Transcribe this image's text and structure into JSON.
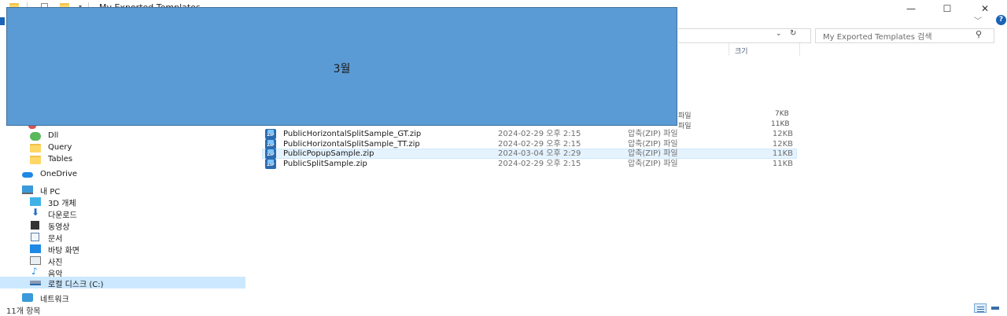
{
  "window": {
    "title": "My Exported Templates",
    "minimize": "—",
    "maximize": "☐",
    "close": "✕"
  },
  "ribbon": {
    "expand_chevron": "﹀",
    "help": "?"
  },
  "search": {
    "placeholder": "My Exported Templates 검색"
  },
  "columns": {
    "size": "크기"
  },
  "overlay": {
    "text": "3월"
  },
  "peek_rows": [
    {
      "type_suffix": "파일",
      "size": "7KB"
    },
    {
      "type_suffix": "파일",
      "size": "11KB"
    }
  ],
  "nav": {
    "items": [
      {
        "label": "Dll"
      },
      {
        "label": "Query"
      },
      {
        "label": "Tables"
      },
      {
        "label": "OneDrive"
      },
      {
        "label": "내 PC"
      },
      {
        "label": "3D 개체"
      },
      {
        "label": "다운로드"
      },
      {
        "label": "동영상"
      },
      {
        "label": "문서"
      },
      {
        "label": "바탕 화면"
      },
      {
        "label": "사진"
      },
      {
        "label": "음악"
      },
      {
        "label": "로컬 디스크 (C:)"
      },
      {
        "label": "네트워크"
      }
    ]
  },
  "files": [
    {
      "name": "PublicHorizontalSplitSample_GT.zip",
      "date": "2024-02-29 오후 2:15",
      "type": "압축(ZIP) 파일",
      "size": "12KB"
    },
    {
      "name": "PublicHorizontalSplitSample_TT.zip",
      "date": "2024-02-29 오후 2:15",
      "type": "압축(ZIP) 파일",
      "size": "12KB"
    },
    {
      "name": "PublicPopupSample.zip",
      "date": "2024-03-04 오후 2:29",
      "type": "압축(ZIP) 파일",
      "size": "11KB"
    },
    {
      "name": "PublicSplitSample.zip",
      "date": "2024-02-29 오후 2:15",
      "type": "압축(ZIP) 파일",
      "size": "11KB"
    }
  ],
  "status": {
    "count": "11개 항목"
  },
  "colors": {
    "accent": "#1a63b6",
    "overlay": "#5b9bd5",
    "selection": "#cce8ff",
    "folder": "#ffd766"
  }
}
